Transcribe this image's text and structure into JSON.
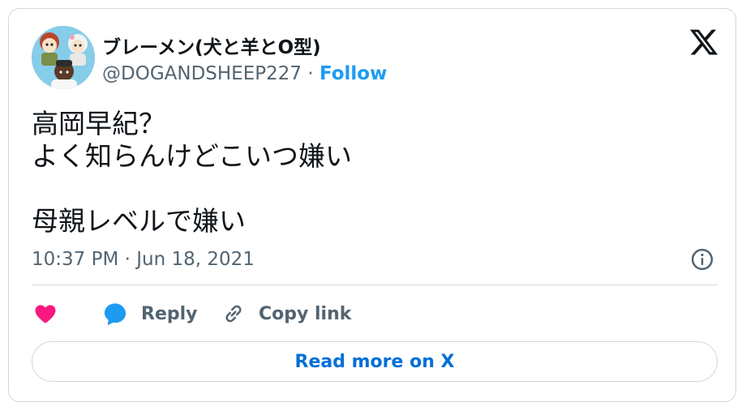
{
  "author": {
    "display_name": "ブレーメン(犬と羊とO型)",
    "handle": "@DOGANDSHEEP227",
    "separator": " · ",
    "follow_label": "Follow",
    "avatar_icon": "avatar-illustration-icon"
  },
  "tweet": {
    "text": "高岡早紀？\nよく知らんけどこいつ嫌い\n\n母親レベルで嫌い",
    "timestamp": "10:37 PM · Jun 18, 2021"
  },
  "actions": {
    "reply_label": "Reply",
    "copy_link_label": "Copy link",
    "read_more_label": "Read more on X"
  },
  "icons": {
    "brand": "x-logo-icon",
    "info": "info-icon",
    "like": "heart-icon",
    "reply": "speech-bubble-icon",
    "copy": "link-icon"
  },
  "colors": {
    "link_blue": "#1d9bf0",
    "read_more_blue": "#006fd6",
    "heart_red": "#f91880",
    "text_primary": "#0f1419",
    "text_secondary": "#536471",
    "border": "#cfd9de"
  }
}
